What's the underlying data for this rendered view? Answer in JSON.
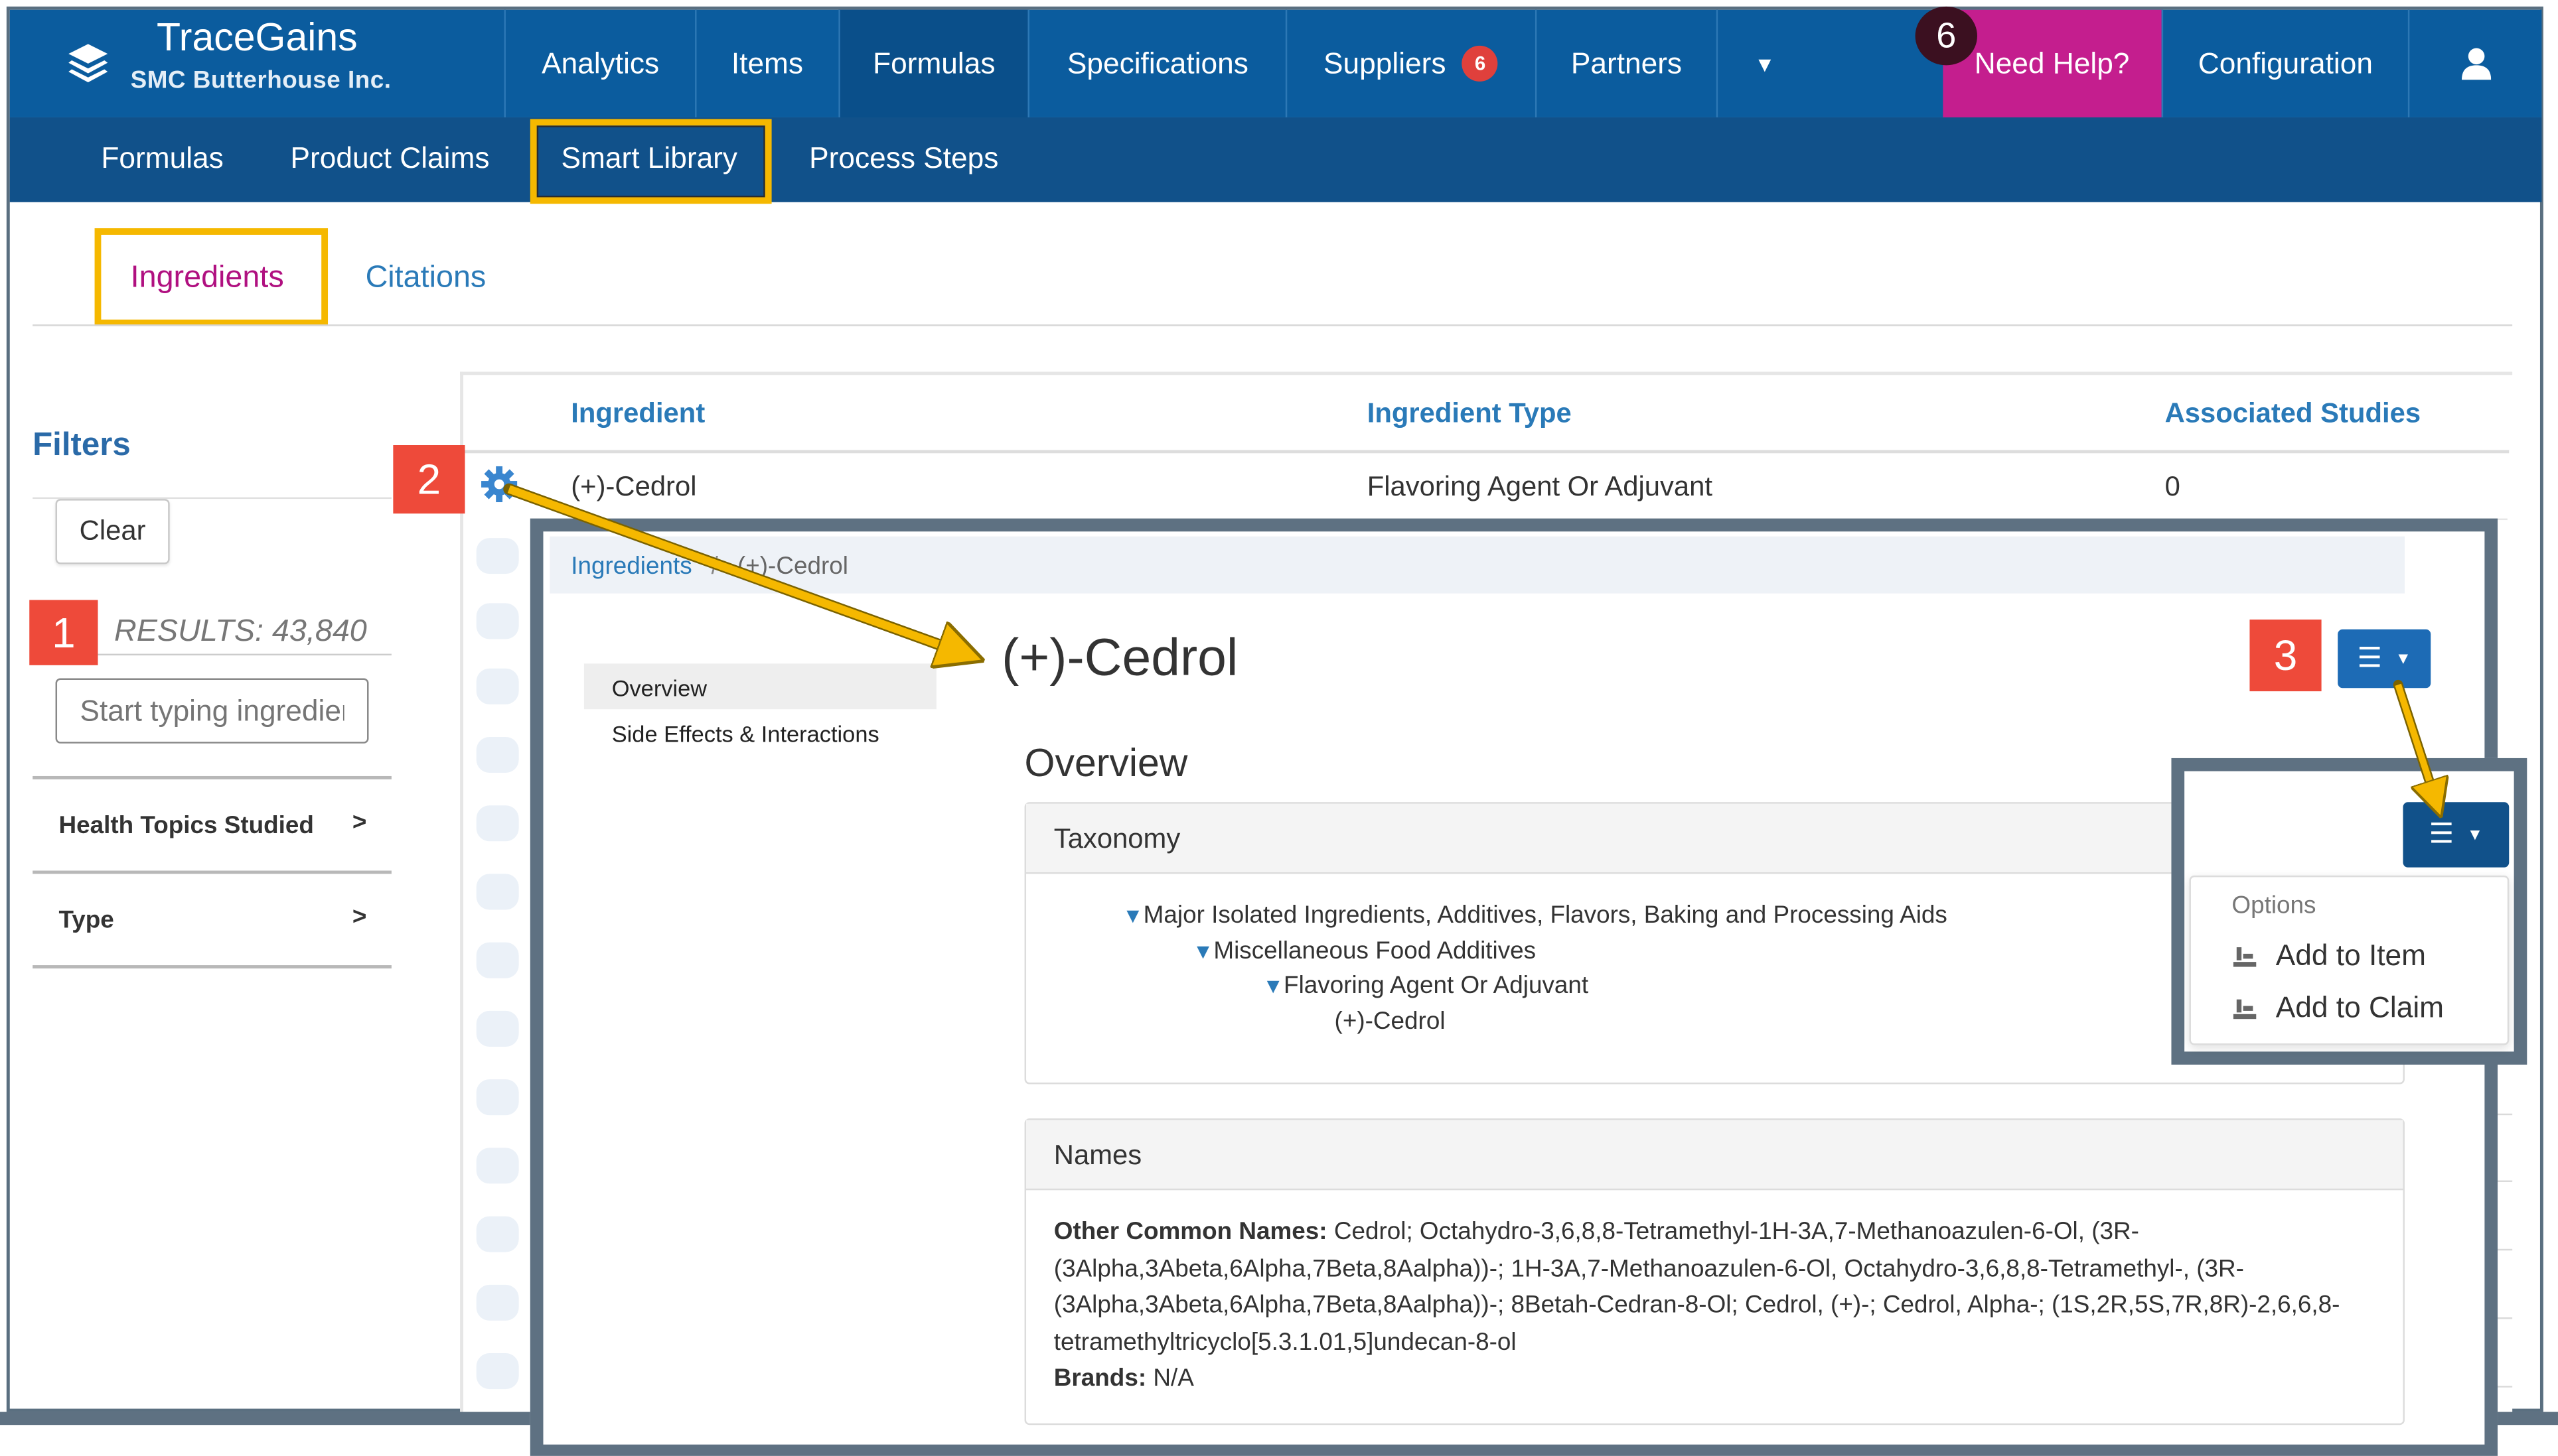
{
  "brand": {
    "name": "TraceGains",
    "company": "SMC Butterhouse Inc."
  },
  "topnav": {
    "items": [
      {
        "label": "Analytics"
      },
      {
        "label": "Items"
      },
      {
        "label": "Formulas"
      },
      {
        "label": "Specifications"
      },
      {
        "label": "Suppliers",
        "badge": "6"
      },
      {
        "label": "Partners"
      }
    ],
    "help_label": "Need Help?",
    "help_count": "6",
    "configuration_label": "Configuration"
  },
  "subnav": {
    "items": [
      "Formulas",
      "Product Claims",
      "Smart Library",
      "Process Steps"
    ]
  },
  "tabs": {
    "ingredients": "Ingredients",
    "citations": "Citations"
  },
  "filters": {
    "title": "Filters",
    "clear_label": "Clear",
    "results_text": "RESULTS: 43,840",
    "search_placeholder": "Start typing ingredient",
    "facets": [
      "Health Topics Studied",
      "Type"
    ]
  },
  "table": {
    "headers": [
      "Ingredient",
      "Ingredient Type",
      "Associated Studies"
    ],
    "rows": [
      {
        "ingredient": "(+)-Cedrol",
        "type": "Flavoring Agent Or Adjuvant",
        "studies": "0"
      }
    ]
  },
  "detail": {
    "breadcrumb": {
      "root": "Ingredients",
      "separator": "/",
      "current": "(+)-Cedrol"
    },
    "title": "(+)-Cedrol",
    "side_menu": [
      "Overview",
      "Side Effects & Interactions"
    ],
    "section_title": "Overview",
    "taxonomy": {
      "title": "Taxonomy",
      "levels": [
        "Major Isolated Ingredients, Additives, Flavors, Baking and Processing Aids",
        "Miscellaneous Food Additives",
        "Flavoring Agent Or Adjuvant",
        "(+)-Cedrol"
      ]
    },
    "names": {
      "title": "Names",
      "other_common_label": "Other Common Names:",
      "other_common_value": "Cedrol; Octahydro-3,6,8,8-Tetramethyl-1H-3A,7-Methanoazulen-6-Ol, (3R-(3Alpha,3Abeta,6Alpha,7Beta,8Aalpha))-; 1H-3A,7-Methanoazulen-6-Ol, Octahydro-3,6,8,8-Tetramethyl-, (3R-(3Alpha,3Abeta,6Alpha,7Beta,8Aalpha))-; 8Betah-Cedran-8-Ol; Cedrol, (+)-; Cedrol, Alpha-; (1S,2R,5S,7R,8R)-2,6,6,8-tetramethyltricyclo[5.3.1.01,5]undecan-8-ol",
      "brands_label": "Brands:",
      "brands_value": "N/A"
    }
  },
  "options_menu": {
    "header": "Options",
    "items": [
      "Add to Item",
      "Add to Claim"
    ]
  },
  "callouts": [
    "1",
    "2",
    "3"
  ],
  "colors": {
    "nav_blue": "#0b5c9e",
    "subnav_blue": "#11518a",
    "help_magenta": "#c41e8e",
    "link_blue": "#2a7ab8",
    "highlight_yellow": "#f5b800",
    "callout_red": "#ee4a3a",
    "button_blue": "#1d6bb5"
  }
}
